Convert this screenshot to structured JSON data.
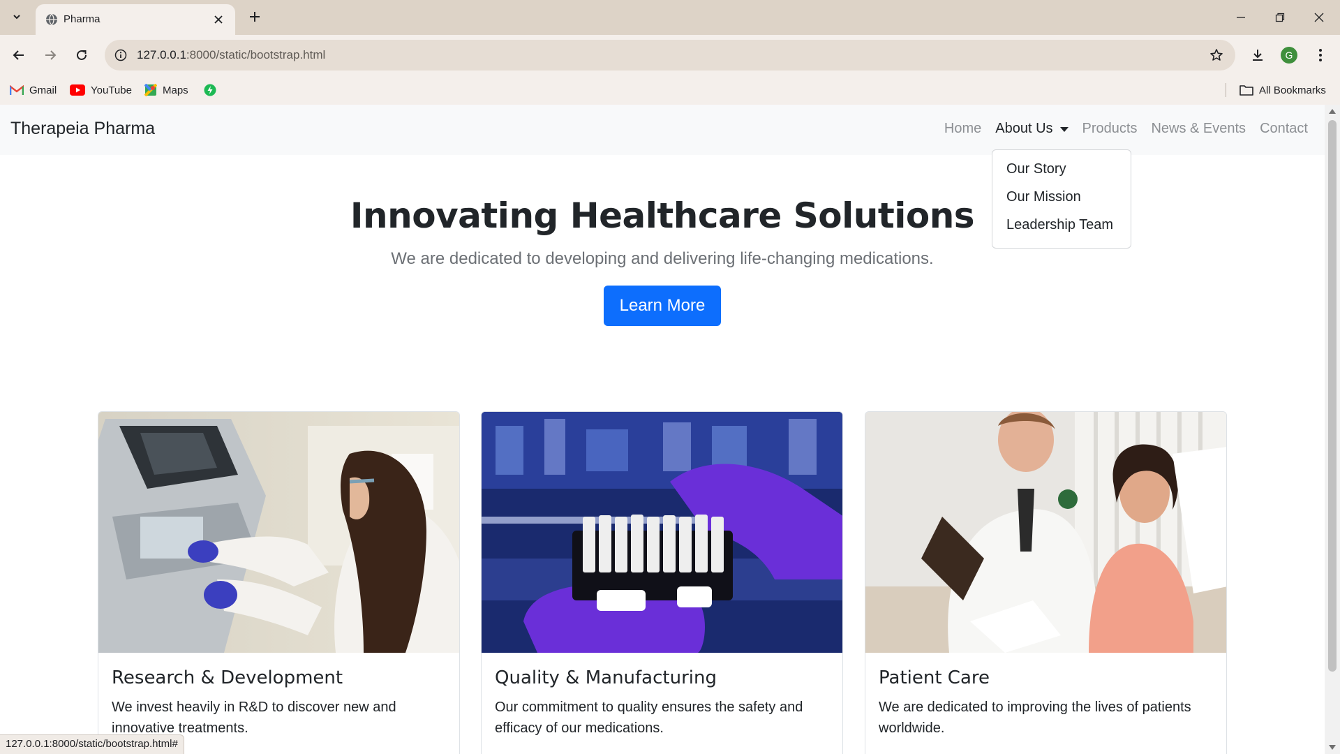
{
  "browser": {
    "tab_title": "Pharma",
    "url_host": "127.0.0.1",
    "url_rest": ":8000/static/bootstrap.html",
    "bookmarks": [
      {
        "label": "Gmail",
        "icon": "gmail-icon"
      },
      {
        "label": "YouTube",
        "icon": "youtube-icon"
      },
      {
        "label": "Maps",
        "icon": "maps-icon"
      }
    ],
    "all_bookmarks": "All Bookmarks",
    "avatar_letter": "G",
    "status_url": "127.0.0.1:8000/static/bootstrap.html#"
  },
  "navbar": {
    "brand": "Therapeia Pharma",
    "links": {
      "home": "Home",
      "about": "About Us",
      "products": "Products",
      "news": "News & Events",
      "contact": "Contact"
    },
    "dropdown": [
      "Our Story",
      "Our Mission",
      "Leadership Team"
    ]
  },
  "hero": {
    "title": "Innovating Healthcare Solutions",
    "subtitle": "We are dedicated to developing and delivering life-changing medications.",
    "button": "Learn More"
  },
  "cards": [
    {
      "title": "Research & Development",
      "text": "We invest heavily in R&D to discover new and innovative treatments."
    },
    {
      "title": "Quality & Manufacturing",
      "text": "Our commitment to quality ensures the safety and efficacy of our medications."
    },
    {
      "title": "Patient Care",
      "text": "We are dedicated to improving the lives of patients worldwide."
    }
  ],
  "colors": {
    "primary": "#0d6efd",
    "navbar_bg": "#f8f9fa",
    "chrome_tabstrip": "#ddd3c7",
    "chrome_toolbar": "#f4efeb"
  }
}
